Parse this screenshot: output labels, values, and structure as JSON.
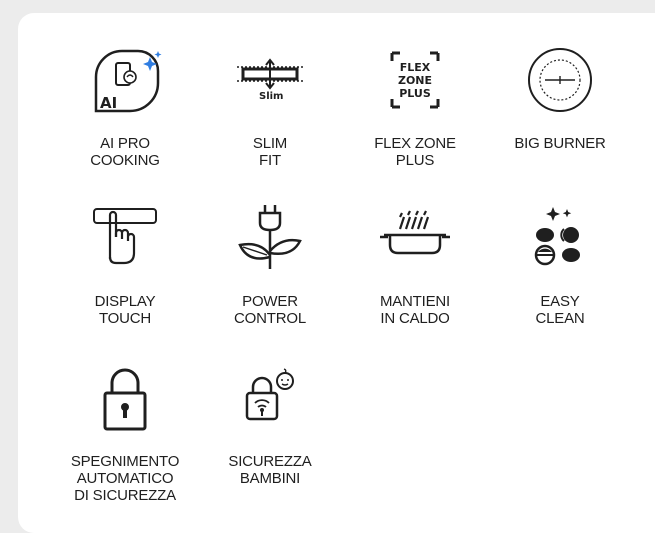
{
  "features": [
    {
      "label": "AI PRO\nCOOKING",
      "icon": "ai-pro-cooking-icon",
      "badge": "AI"
    },
    {
      "label": "SLIM\nFIT",
      "icon": "slim-fit-icon",
      "badge": "Slim"
    },
    {
      "label": "FLEX ZONE\nPLUS",
      "icon": "flex-zone-plus-icon",
      "badge": "FLEX\nZONE\nPLUS"
    },
    {
      "label": "BIG BURNER",
      "icon": "big-burner-icon"
    },
    {
      "label": "DISPLAY\nTOUCH",
      "icon": "display-touch-icon"
    },
    {
      "label": "POWER\nCONTROL",
      "icon": "power-control-icon"
    },
    {
      "label": "MANTIENI\nIN CALDO",
      "icon": "keep-warm-icon"
    },
    {
      "label": "EASY\nCLEAN",
      "icon": "easy-clean-icon"
    },
    {
      "label": "SPEGNIMENTO\nAUTOMATICO\nDI SICUREZZA",
      "icon": "auto-shutoff-lock-icon"
    },
    {
      "label": "SICUREZZA\nBAMBINI",
      "icon": "child-lock-icon"
    }
  ],
  "colors": {
    "accent": "#2f7de1",
    "ink": "#1f1f1f",
    "background": "#ececec"
  }
}
